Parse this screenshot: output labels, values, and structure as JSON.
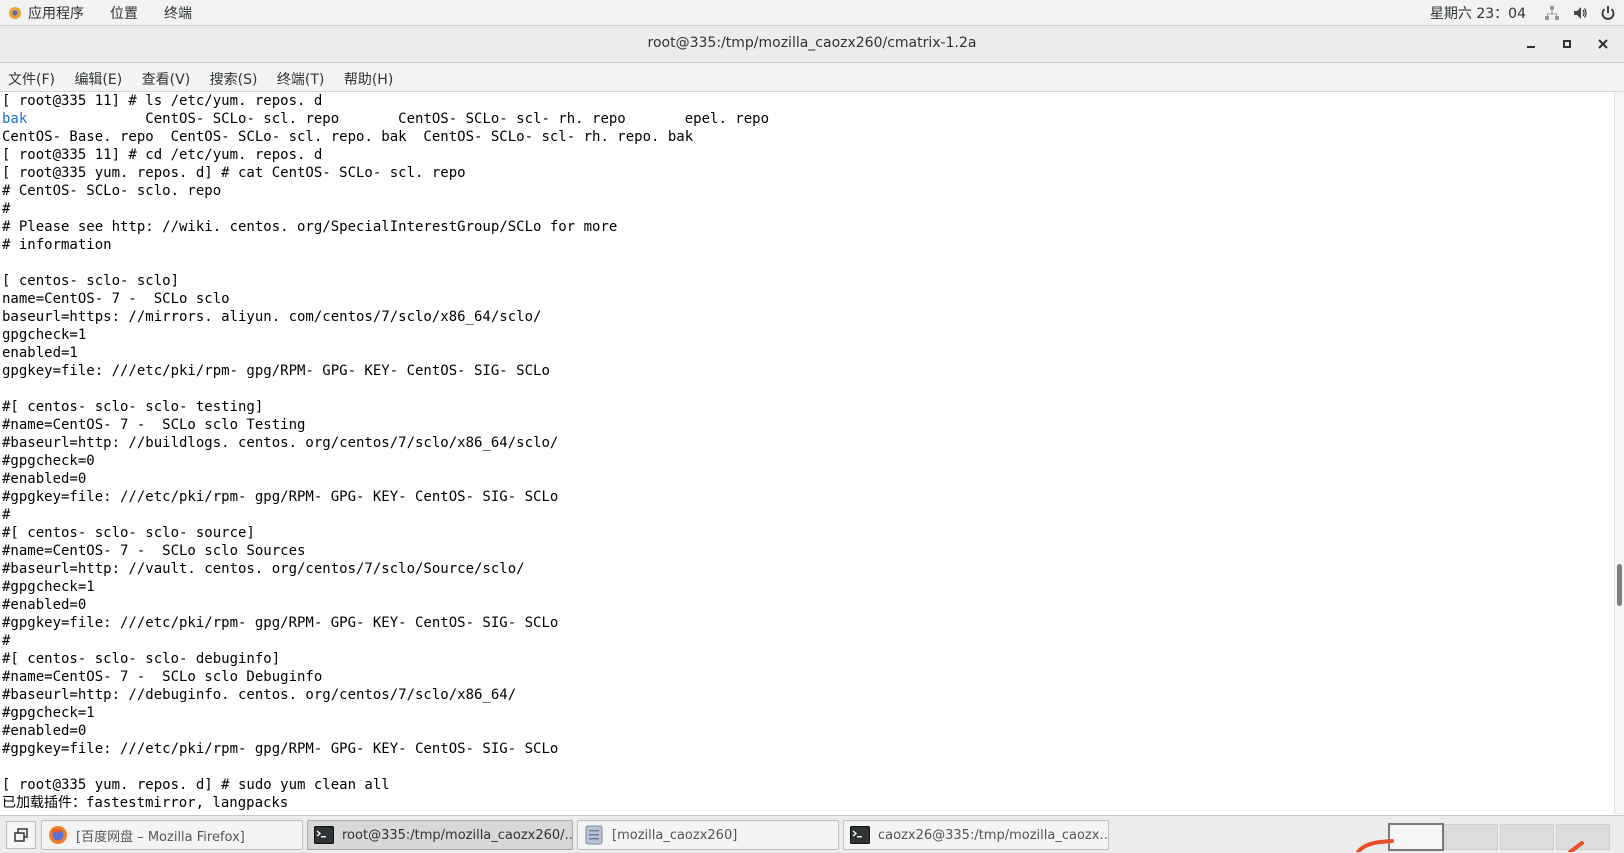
{
  "topbar": {
    "menus": [
      "应用程序",
      "位置",
      "终端"
    ],
    "clock": "星期六 23：04"
  },
  "window": {
    "title": "root@335:/tmp/mozilla_caozx260/cmatrix-1.2a",
    "controls": [
      "minimize",
      "maximize",
      "close"
    ]
  },
  "menubar": [
    "文件(F)",
    "编辑(E)",
    "查看(V)",
    "搜索(S)",
    "终端(T)",
    "帮助(H)"
  ],
  "terminal": {
    "lines": [
      "[ root@335 11] # ls /etc/yum. repos. d",
      "",
      "CentOS- Base. repo  CentOS- SCLo- scl. repo. bak  CentOS- SCLo- scl- rh. repo. bak",
      "[ root@335 11] # cd /etc/yum. repos. d",
      "[ root@335 yum. repos. d] # cat CentOS- SCLo- scl. repo",
      "# CentOS- SCLo- sclo. repo",
      "#",
      "# Please see http: //wiki. centos. org/SpecialInterestGroup/SCLo for more",
      "# information",
      "",
      "[ centos- sclo- sclo]",
      "name=CentOS- 7 -  SCLo sclo",
      "baseurl=https: //mirrors. aliyun. com/centos/7/sclo/x86_64/sclo/",
      "gpgcheck=1",
      "enabled=1",
      "gpgkey=file: ///etc/pki/rpm- gpg/RPM- GPG- KEY- CentOS- SIG- SCLo",
      "",
      "#[ centos- sclo- sclo- testing]",
      "#name=CentOS- 7 -  SCLo sclo Testing",
      "#baseurl=http: //buildlogs. centos. org/centos/7/sclo/x86_64/sclo/",
      "#gpgcheck=0",
      "#enabled=0",
      "#gpgkey=file: ///etc/pki/rpm- gpg/RPM- GPG- KEY- CentOS- SIG- SCLo",
      "#",
      "#[ centos- sclo- sclo- source]",
      "#name=CentOS- 7 -  SCLo sclo Sources",
      "#baseurl=http: //vault. centos. org/centos/7/sclo/Source/sclo/",
      "#gpgcheck=1",
      "#enabled=0",
      "#gpgkey=file: ///etc/pki/rpm- gpg/RPM- GPG- KEY- CentOS- SIG- SCLo",
      "#",
      "#[ centos- sclo- sclo- debuginfo]",
      "#name=CentOS- 7 -  SCLo sclo Debuginfo",
      "#baseurl=http: //debuginfo. centos. org/centos/7/sclo/x86_64/",
      "#gpgcheck=1",
      "#enabled=0",
      "#gpgkey=file: ///etc/pki/rpm- gpg/RPM- GPG- KEY- CentOS- SIG- SCLo",
      "",
      "[ root@335 yum. repos. d] # sudo yum clean all",
      "已加载插件：fastestmirror, langpacks"
    ],
    "ls_row": {
      "dir": "bak",
      "rest": "              CentOS- SCLo- scl. repo       CentOS- SCLo- scl- rh. repo       epel. repo"
    },
    "dir_color": "#1e6fd9"
  },
  "taskbar": {
    "tasks": [
      {
        "label": "[百度网盘 – Mozilla Firefox]",
        "icon": "firefox-icon"
      },
      {
        "label": "root@335:/tmp/mozilla_caozx260/…",
        "icon": "terminal-icon"
      },
      {
        "label": "[mozilla_caozx260]",
        "icon": "file-manager-icon"
      },
      {
        "label": "caozx26@335:/tmp/mozilla_caozx…",
        "icon": "terminal-icon"
      }
    ]
  }
}
